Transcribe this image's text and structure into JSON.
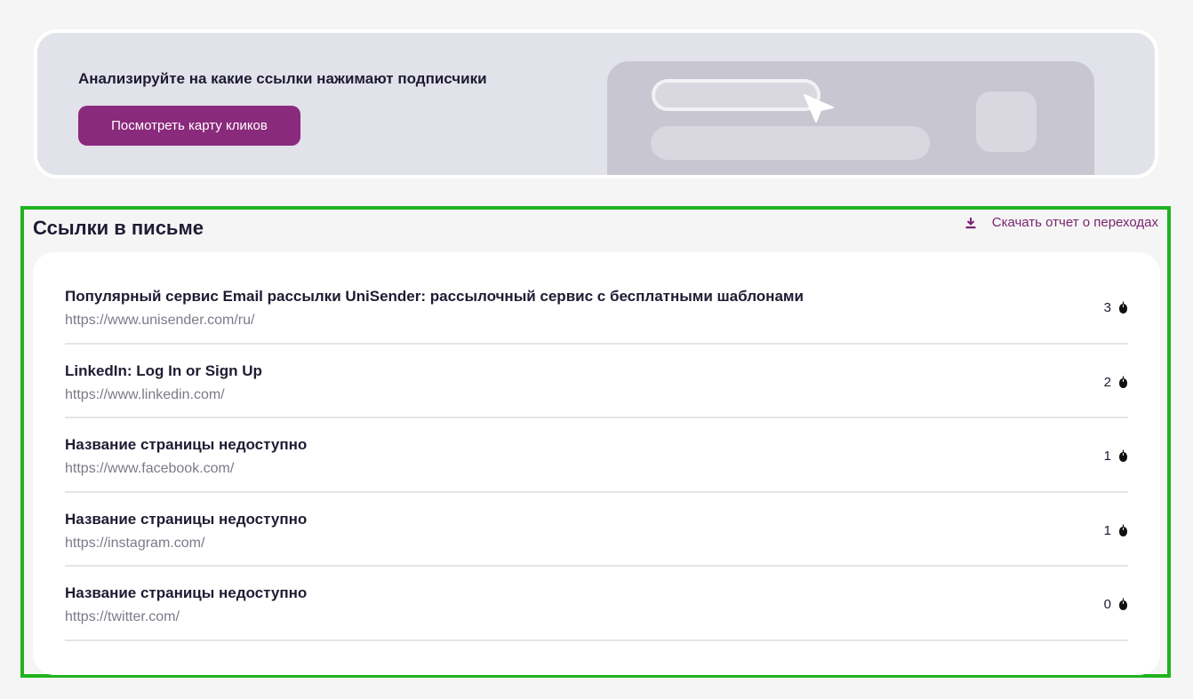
{
  "promo": {
    "heading": "Анализируйте на какие ссылки нажимают подписчики",
    "button_label": "Посмотреть карту кликов"
  },
  "links_section": {
    "title": "Ссылки в письме",
    "download_label": "Скачать отчет о переходах",
    "items": [
      {
        "title": "Популярный сервис Email рассылки UniSender: рассылочный сервис с бесплатными шаблонами",
        "url": "https://www.unisender.com/ru/",
        "clicks": "3"
      },
      {
        "title": "LinkedIn: Log In or Sign Up",
        "url": "https://www.linkedin.com/",
        "clicks": "2"
      },
      {
        "title": "Название страницы недоступно",
        "url": "https://www.facebook.com/",
        "clicks": "1"
      },
      {
        "title": "Название страницы недоступно",
        "url": "https://instagram.com/",
        "clicks": "1"
      },
      {
        "title": "Название страницы недоступно",
        "url": "https://twitter.com/",
        "clicks": "0"
      }
    ]
  },
  "icons": {
    "download": "download-icon",
    "clicks": "mouse-icon"
  },
  "colors": {
    "accent": "#8a2a7c",
    "highlight_border": "#1fb31f",
    "promo_bg": "#e1e2ea"
  }
}
